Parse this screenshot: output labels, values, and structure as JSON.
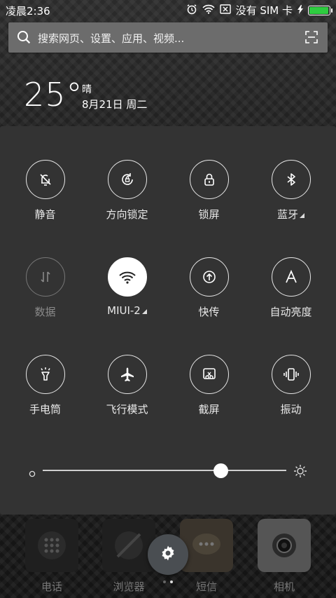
{
  "status_bar": {
    "time": "凌晨2:36",
    "carrier": "没有 SIM 卡",
    "battery_level": 0.95,
    "battery_color": "#2ecc40"
  },
  "search": {
    "placeholder": "搜索网页、设置、应用、视频..."
  },
  "weather": {
    "temperature": "25°",
    "condition": "晴",
    "date": "8月21日 周二"
  },
  "toggles": [
    {
      "label": "静音",
      "icon": "bell-off-icon",
      "state": "on"
    },
    {
      "label": "方向锁定",
      "icon": "rotation-lock-icon",
      "state": "on"
    },
    {
      "label": "锁屏",
      "icon": "lock-icon",
      "state": "on"
    },
    {
      "label": "蓝牙",
      "icon": "bluetooth-icon",
      "state": "on",
      "has_menu": true
    },
    {
      "label": "数据",
      "icon": "mobile-data-icon",
      "state": "disabled"
    },
    {
      "label": "MIUI-2",
      "icon": "wifi-icon",
      "state": "active",
      "has_menu": true
    },
    {
      "label": "快传",
      "icon": "upload-icon",
      "state": "on"
    },
    {
      "label": "自动亮度",
      "icon": "auto-brightness-icon",
      "state": "on"
    },
    {
      "label": "手电筒",
      "icon": "flashlight-icon",
      "state": "on"
    },
    {
      "label": "飞行模式",
      "icon": "airplane-icon",
      "state": "on"
    },
    {
      "label": "截屏",
      "icon": "screenshot-icon",
      "state": "on"
    },
    {
      "label": "振动",
      "icon": "vibrate-icon",
      "state": "on"
    }
  ],
  "brightness": {
    "level": 0.73
  },
  "dock": [
    {
      "label": "电话",
      "icon": "phone-icon"
    },
    {
      "label": "浏览器",
      "icon": "browser-icon"
    },
    {
      "label": "短信",
      "icon": "message-icon"
    },
    {
      "label": "相机",
      "icon": "camera-icon"
    }
  ],
  "colors": {
    "panel": "#333333",
    "accent_active": "#ffffff"
  }
}
